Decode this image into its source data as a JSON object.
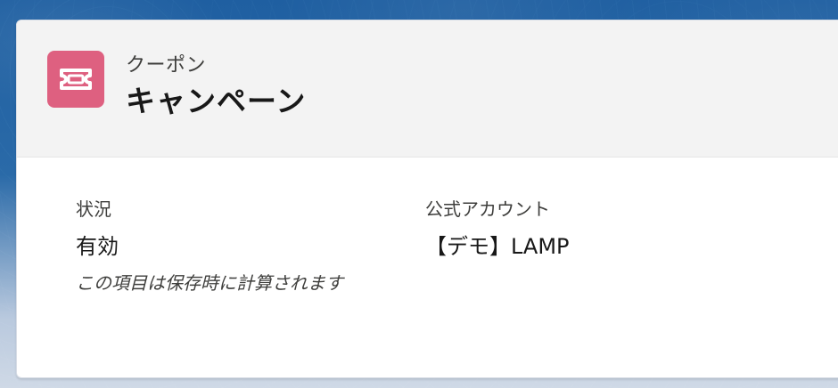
{
  "header": {
    "object_type": "クーポン",
    "record_title": "キャンペーン",
    "icon": "ticket-icon",
    "icon_color": "#de6080"
  },
  "fields": {
    "status": {
      "label": "状況",
      "value": "有効",
      "help_text": "この項目は保存時に計算されます"
    },
    "official_account": {
      "label": "公式アカウント",
      "value": "【デモ】LAMP"
    }
  }
}
